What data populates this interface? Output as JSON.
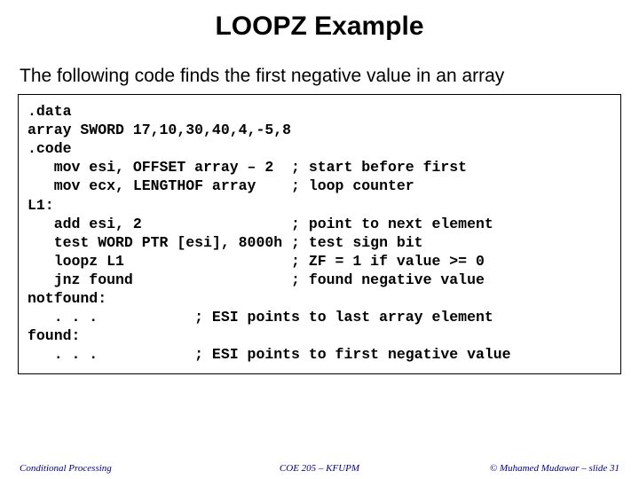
{
  "title": "LOOPZ Example",
  "subtitle": "The following code finds the first negative value in an array",
  "code": ".data\narray SWORD 17,10,30,40,4,-5,8\n.code\n   mov esi, OFFSET array – 2  ; start before first\n   mov ecx, LENGTHOF array    ; loop counter\nL1:\n   add esi, 2                 ; point to next element\n   test WORD PTR [esi], 8000h ; test sign bit\n   loopz L1                   ; ZF = 1 if value >= 0\n   jnz found                  ; found negative value\nnotfound:\n   . . .           ; ESI points to last array element\nfound:\n   . . .           ; ESI points to first negative value",
  "footer": {
    "left": "Conditional Processing",
    "center": "COE 205 – KFUPM",
    "right": "© Muhamed Mudawar – slide 31"
  }
}
